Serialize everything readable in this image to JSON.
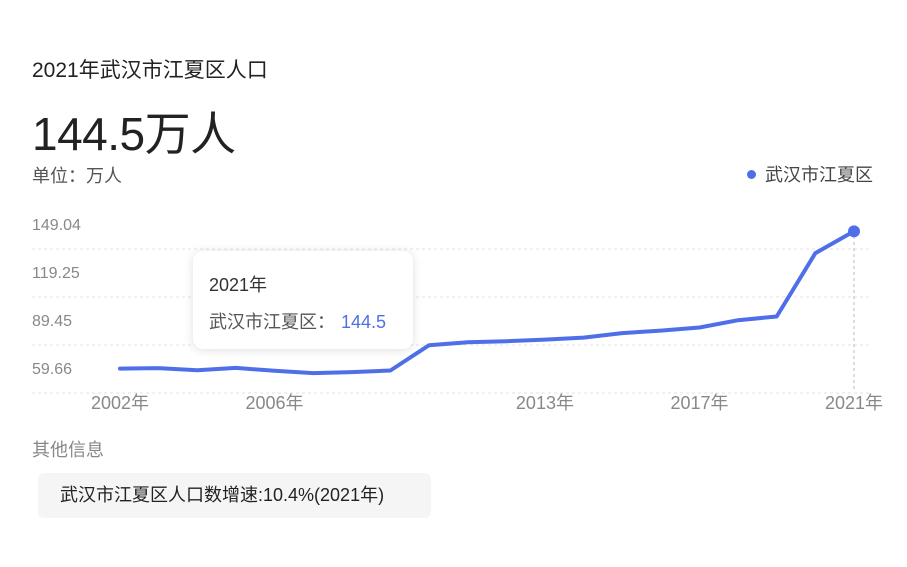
{
  "header": {
    "title": "2021年武汉市江夏区人口",
    "value": "144.5万人",
    "unit": "单位：万人"
  },
  "legend": {
    "label": "武汉市江夏区",
    "color": "#4f6fe8"
  },
  "tooltip": {
    "year": "2021年",
    "series": "武汉市江夏区：",
    "value": "144.5"
  },
  "other": {
    "label": "其他信息",
    "chip": "武汉市江夏区人口数增速:10.4%(2021年)"
  },
  "chart_data": {
    "type": "line",
    "x": [
      2002,
      2003,
      2004,
      2005,
      2006,
      2007,
      2008,
      2009,
      2010,
      2011,
      2012,
      2013,
      2014,
      2015,
      2016,
      2017,
      2018,
      2019,
      2020,
      2021
    ],
    "x_tick_labels": [
      "2002年",
      "2006年",
      "2013年",
      "2017年",
      "2021年"
    ],
    "x_ticks": [
      2002,
      2006,
      2013,
      2017,
      2021
    ],
    "y_ticks": [
      59.66,
      89.45,
      119.25,
      149.04
    ],
    "y_tick_labels": [
      "59.66",
      "89.45",
      "119.25",
      "149.04"
    ],
    "ylim": [
      59.66,
      149.04
    ],
    "series": [
      {
        "name": "武汉市江夏区",
        "color": "#4f6fe8",
        "values": [
          59.3,
          59.6,
          58.3,
          59.7,
          57.9,
          56.5,
          57.1,
          58.1,
          73.8,
          75.6,
          76.3,
          77.3,
          78.5,
          81.3,
          82.9,
          84.8,
          89.3,
          91.6,
          131.0,
          144.5
        ]
      }
    ],
    "highlight_index": 19,
    "grid": true
  }
}
